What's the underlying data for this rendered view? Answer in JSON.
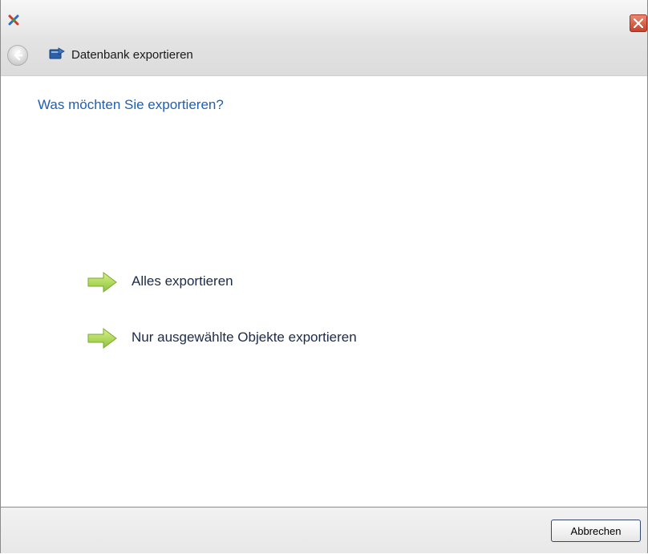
{
  "window": {
    "title": ""
  },
  "nav": {
    "title": "Datenbank exportieren"
  },
  "page": {
    "heading": "Was möchten Sie exportieren?"
  },
  "options": [
    {
      "label": "Alles exportieren",
      "icon": "arrow-right-icon"
    },
    {
      "label": "Nur ausgewählte Objekte exportieren",
      "icon": "arrow-right-icon"
    }
  ],
  "footer": {
    "cancel_label": "Abbrechen"
  },
  "colors": {
    "heading": "#1e5fb4",
    "option_text": "#1c2a4a",
    "arrow": "#9fd24b",
    "close": "#c8402a"
  }
}
